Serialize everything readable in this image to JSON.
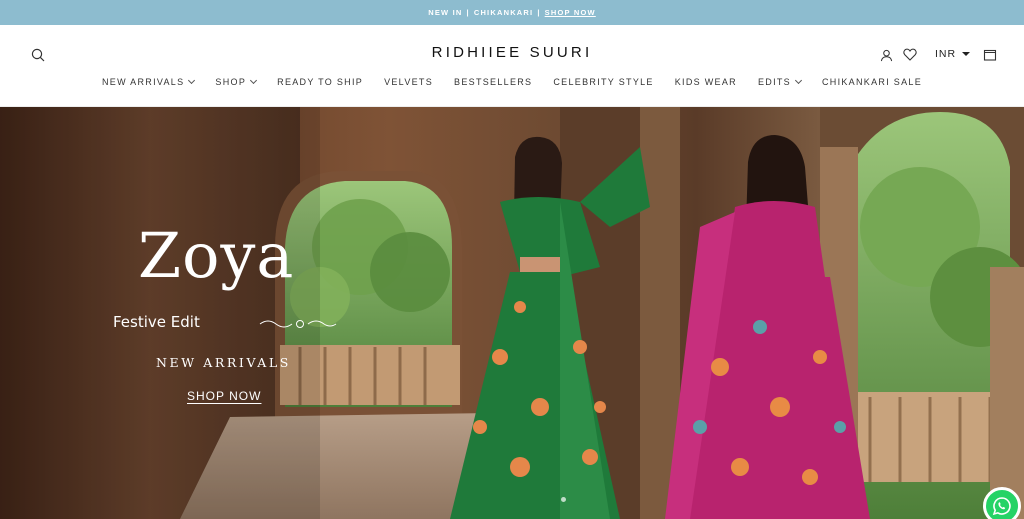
{
  "announcement": {
    "part1": "NEW IN",
    "separator": "|",
    "part2": "CHIKANKARI",
    "link": "SHOP NOW"
  },
  "header": {
    "logo": "RIDHIIEE SUURI",
    "currency": "INR",
    "icons": [
      "search-icon",
      "user-icon",
      "heart-icon",
      "bag-icon"
    ]
  },
  "nav": {
    "items": [
      {
        "label": "NEW ARRIVALS",
        "dropdown": true
      },
      {
        "label": "SHOP",
        "dropdown": true
      },
      {
        "label": "READY TO SHIP",
        "dropdown": false
      },
      {
        "label": "VELVETS",
        "dropdown": false
      },
      {
        "label": "BESTSELLERS",
        "dropdown": false
      },
      {
        "label": "CELEBRITY STYLE",
        "dropdown": false
      },
      {
        "label": "KIDS WEAR",
        "dropdown": false
      },
      {
        "label": "EDITS",
        "dropdown": true
      },
      {
        "label": "CHIKANKARI SALE",
        "dropdown": false
      }
    ]
  },
  "hero": {
    "title": "Zoya",
    "subtitle": "Festive Edit",
    "tagline": "NEW ARRIVALS",
    "cta": "SHOP NOW"
  },
  "colors": {
    "announcement_bg": "#8dbccf",
    "whatsapp": "#25d366",
    "lehenga_green": "#1f7a3a",
    "lehenga_pink": "#b8236e"
  }
}
